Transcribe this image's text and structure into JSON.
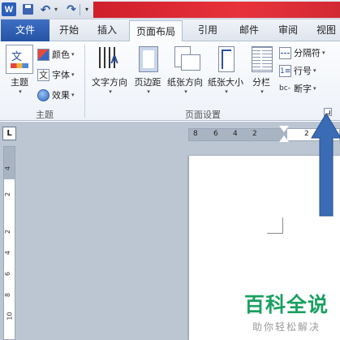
{
  "quick_access": {
    "app_logo": "W",
    "undo_icon": "↶",
    "redo_icon": "↷",
    "dropdown_caret": "▾",
    "customize_caret": "▾"
  },
  "tabs": [
    {
      "label": "文件"
    },
    {
      "label": "开始"
    },
    {
      "label": "插入"
    },
    {
      "label": "页面布局"
    },
    {
      "label": "引用"
    },
    {
      "label": "邮件"
    },
    {
      "label": "审阅"
    },
    {
      "label": "视图"
    }
  ],
  "ribbon": {
    "themes": {
      "theme_label": "主题",
      "colors_label": "颜色",
      "fonts_label": "字体",
      "effects_label": "效果",
      "group_label": "主题"
    },
    "page_setup": {
      "text_direction": "文字方向",
      "margins": "页边距",
      "orientation": "纸张方向",
      "size": "纸张大小",
      "columns": "分栏",
      "breaks": "分隔符",
      "line_numbers": "行号",
      "hyphenation": "断字",
      "group_label": "页面设置"
    }
  },
  "rulers": {
    "corner_symbol": "L",
    "horizontal_ticks": [
      "8",
      "6",
      "4",
      "2",
      "2"
    ],
    "vertical_ticks": [
      "4",
      "2",
      "2",
      "4",
      "6",
      "8",
      "10"
    ]
  },
  "watermark": {
    "title": "百科全说",
    "subtitle": "助你轻松解决"
  },
  "colors": {
    "file_tab": "#2b5fb8",
    "title_bar_accent": "#e0303a",
    "arrow": "#3a6bb5",
    "watermark_green": "#1aa060"
  }
}
